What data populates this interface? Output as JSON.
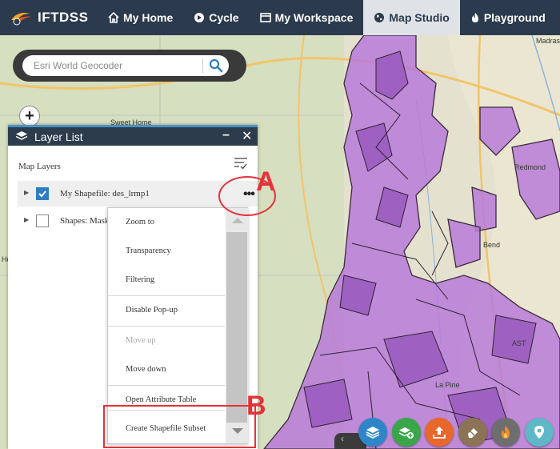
{
  "nav": {
    "brand": "IFTDSS",
    "items": [
      {
        "label": "My Home",
        "icon": "home-icon"
      },
      {
        "label": "Cycle",
        "icon": "cycle-icon"
      },
      {
        "label": "My Workspace",
        "icon": "workspace-icon"
      },
      {
        "label": "Map Studio",
        "icon": "globe-icon",
        "active": true
      },
      {
        "label": "Playground",
        "icon": "flame-icon"
      }
    ]
  },
  "geocoder": {
    "placeholder": "Esri World Geocoder"
  },
  "zoom": {
    "in_label": "+"
  },
  "map": {
    "labels": {
      "sweet_home": "Sweet Home",
      "redmond": "Redmond",
      "bend": "Bend",
      "la_pine": "La Pine",
      "madras": "Madras",
      "ast": "AST",
      "ho": "Ho"
    }
  },
  "layer_list": {
    "title": "Layer List",
    "minimize": "–",
    "close": "✕",
    "section_label": "Map Layers",
    "layers": [
      {
        "name": "My Shapefile: des_lrmp1",
        "checked": true
      },
      {
        "name": "Shapes: Mask",
        "checked": false
      }
    ],
    "more_label": "•••"
  },
  "context_menu": {
    "items": [
      {
        "label": "Zoom to",
        "enabled": true
      },
      {
        "label": "Transparency",
        "enabled": true
      },
      {
        "label": "Filtering",
        "enabled": true
      },
      {
        "label": "Disable Pop-up",
        "enabled": true
      },
      {
        "label": "Move up",
        "enabled": false
      },
      {
        "label": "Move down",
        "enabled": true
      },
      {
        "label": "Open Attribute Table",
        "enabled": true
      },
      {
        "label": "Create Shapefile Subset",
        "enabled": true
      }
    ]
  },
  "annotations": {
    "a": "A",
    "b": "B",
    "color": "#e53238"
  },
  "toolbar": {
    "edge_label": "‹",
    "buttons": [
      {
        "icon": "layers-icon",
        "color": "#2e86c8"
      },
      {
        "icon": "layer-add-icon",
        "color": "#3aa64a"
      },
      {
        "icon": "upload-icon",
        "color": "#e8682c"
      },
      {
        "icon": "eraser-icon",
        "color": "#8b7355"
      },
      {
        "icon": "fire-icon",
        "color": "#6e6e6e"
      },
      {
        "icon": "pin-icon",
        "color": "#5fb8c8"
      }
    ]
  },
  "colors": {
    "navbar": "#2b3a4c",
    "panel_header": "#2d3c4c",
    "accent": "#2d7fc2",
    "shapefile": "#b06ad0"
  }
}
